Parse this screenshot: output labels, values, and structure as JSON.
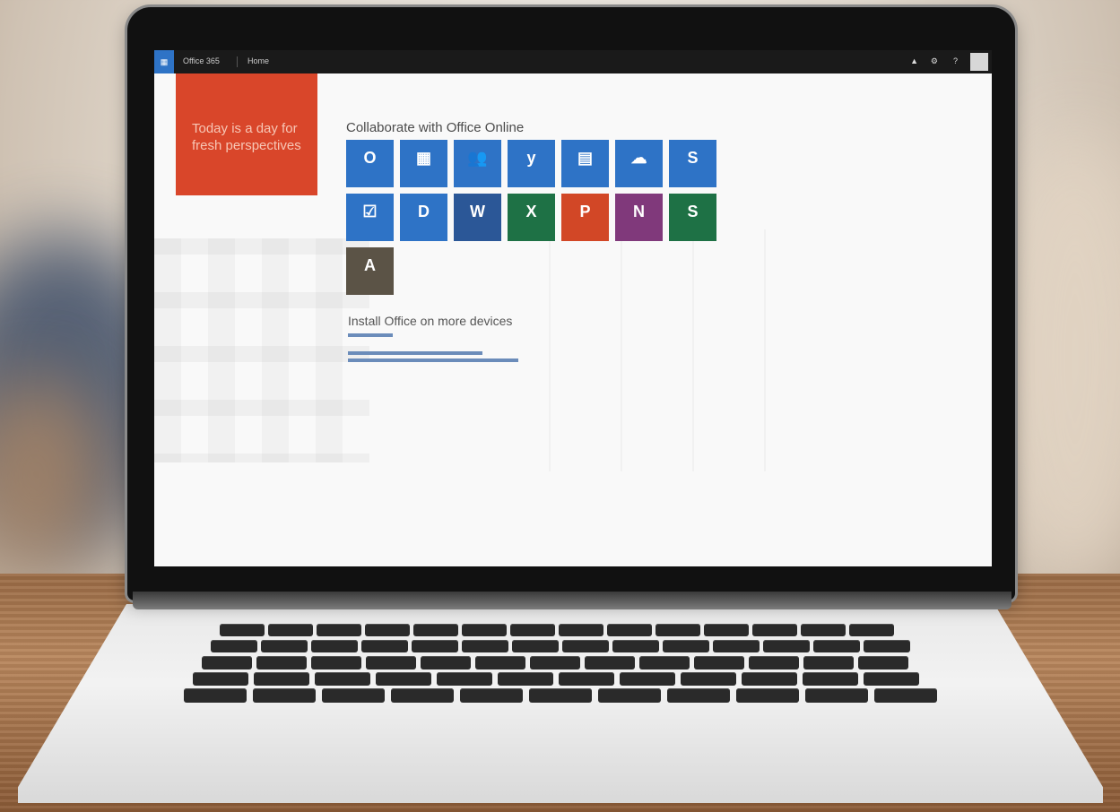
{
  "topbar": {
    "launcher_icon": "app-launcher-icon",
    "app_name": "Office 365",
    "nav_home": "Home",
    "icons": [
      "bell-icon",
      "gear-icon",
      "help-icon"
    ]
  },
  "promo": {
    "text": "Today is a day for fresh perspectives",
    "color": "#d9462a"
  },
  "collaborate": {
    "title": "Collaborate with Office Online",
    "tiles": [
      {
        "name": "mail-tile",
        "glyph": "O",
        "icon": "outlook-icon",
        "color": "#2e73c6"
      },
      {
        "name": "calendar-tile",
        "glyph": "▦",
        "icon": "calendar-icon",
        "color": "#2e73c6"
      },
      {
        "name": "people-tile",
        "glyph": "👥",
        "icon": "people-icon",
        "color": "#2e73c6"
      },
      {
        "name": "yammer-tile",
        "glyph": "y",
        "icon": "yammer-icon",
        "color": "#2e73c6"
      },
      {
        "name": "newsfeed-tile",
        "glyph": "▤",
        "icon": "newsfeed-icon",
        "color": "#2e73c6"
      },
      {
        "name": "onedrive-tile",
        "glyph": "☁",
        "icon": "onedrive-icon",
        "color": "#2e73c6"
      },
      {
        "name": "sites-tile",
        "glyph": "S",
        "icon": "sharepoint-icon",
        "color": "#2e73c6"
      },
      {
        "name": "tasks-tile",
        "glyph": "☑",
        "icon": "tasks-icon",
        "color": "#2e73c6"
      },
      {
        "name": "delve-tile",
        "glyph": "D",
        "icon": "delve-icon",
        "color": "#2e73c6"
      },
      {
        "name": "word-online-tile",
        "glyph": "W",
        "icon": "word-icon",
        "color": "#2b5797"
      },
      {
        "name": "excel-online-tile",
        "glyph": "X",
        "icon": "excel-icon",
        "color": "#1e7145"
      },
      {
        "name": "powerpoint-online-tile",
        "glyph": "P",
        "icon": "powerpoint-icon",
        "color": "#d24726"
      },
      {
        "name": "onenote-online-tile",
        "glyph": "N",
        "icon": "onenote-icon",
        "color": "#80397b"
      },
      {
        "name": "sway-tile",
        "glyph": "S",
        "icon": "sway-icon",
        "color": "#1e7145"
      },
      {
        "name": "admin-tile",
        "glyph": "A",
        "icon": "admin-icon",
        "color": "#5b5346"
      }
    ]
  },
  "install": {
    "title": "Install Office on more devices"
  }
}
